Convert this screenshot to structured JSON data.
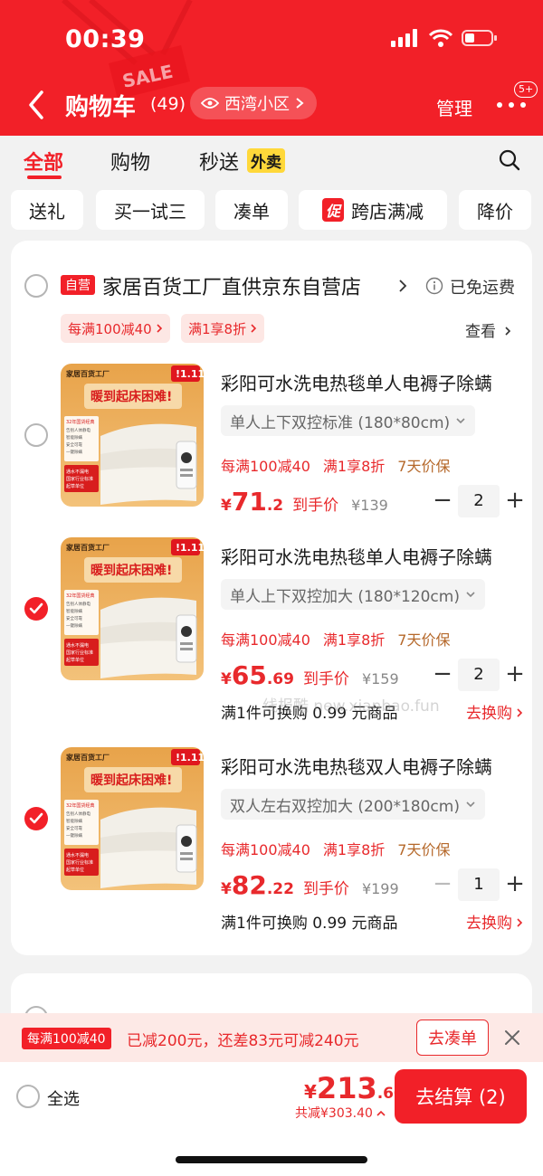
{
  "status_bar": {
    "time": "00:39"
  },
  "header": {
    "title": "购物车",
    "count": "(49)",
    "location": "西湾小区",
    "manage": "管理",
    "badge": "5+"
  },
  "tabs": [
    {
      "label": "全部"
    },
    {
      "label": "购物"
    },
    {
      "label": "秒送"
    }
  ],
  "waimai_badge": "外卖",
  "filters": [
    "送礼",
    "买一试三",
    "凑单",
    "跨店满减",
    "降价"
  ],
  "promo_icon_label": "促",
  "store": {
    "self_badge": "自营",
    "name": "家居百货工厂直供京东自营店",
    "shipping": "已免运费",
    "promos": [
      "每满100减40",
      "满1享8折"
    ],
    "view": "查看"
  },
  "products": [
    {
      "title": "彩阳可水洗电热毯单人电褥子除螨",
      "spec": "单人上下双控标准 (180*80cm)",
      "tags": [
        "每满100减40",
        "满1享8折",
        "7天价保"
      ],
      "price_int": "71",
      "price_dec": ".2",
      "to_hand": "到手价",
      "original": "¥139",
      "qty": "2",
      "checked": false,
      "swap_text": "",
      "swap_link": ""
    },
    {
      "title": "彩阳可水洗电热毯单人电褥子除螨",
      "spec": "单人上下双控加大 (180*120cm)",
      "tags": [
        "每满100减40",
        "满1享8折",
        "7天价保"
      ],
      "price_int": "65",
      "price_dec": ".69",
      "to_hand": "到手价",
      "original": "¥159",
      "qty": "2",
      "checked": true,
      "swap_text": "满1件可换购 0.99 元商品",
      "swap_link": "去换购"
    },
    {
      "title": "彩阳可水洗电热毯双人电褥子除螨",
      "spec": "双人左右双控加大 (200*180cm)",
      "tags": [
        "每满100减40",
        "满1享8折",
        "7天价保"
      ],
      "price_int": "82",
      "price_dec": ".22",
      "to_hand": "到手价",
      "original": "¥199",
      "qty": "1",
      "checked": true,
      "swap_text": "满1件可换购 0.99 元商品",
      "swap_link": "去换购"
    }
  ],
  "thumb": {
    "brand_text": "家居百货工厂",
    "headline": "暖到起床困难!",
    "event_badge": "!1.11",
    "features": [
      "32年国货经典",
      "告别人体静电",
      "智能除螨",
      "安全可靠",
      "一键除螨"
    ],
    "safety": [
      "通水不漏电",
      "国家行业标准",
      "起草单位"
    ]
  },
  "watermark": "线报酷 new.xianbao.fun",
  "promo_bar": {
    "tag": "每满100减40",
    "text": "已减200元，还差83元可减240元",
    "button": "去凑单"
  },
  "bottom": {
    "select_all": "全选",
    "total_int": "213",
    "total_dec": ".60",
    "discount": "共减¥303.40",
    "checkout": "去结算 (2)"
  },
  "colors": {
    "brand_red": "#f22028",
    "text_dark": "#1a1a1a",
    "muted": "#888888",
    "promo_bg": "#fde9e6"
  }
}
